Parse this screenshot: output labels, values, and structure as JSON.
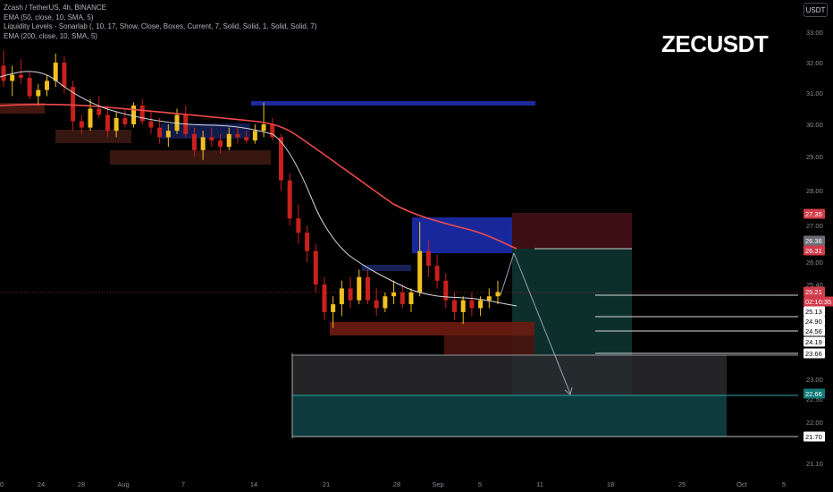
{
  "legend": {
    "symbol_line": "Zcash / TetherUS, 4h, BINANCE",
    "ema50_line": "EMA (50, close, 10, SMA, 5)",
    "liquidity_line": "Liquidity Levels - Sonarlab (, 10, 17, Show, Close, Boxes, Current, 7, Solid, Solid, 1, Solid, Solid, 7)",
    "ema200_line": "EMA (200, close, 10, SMA, 5)"
  },
  "title": "ZECUSDT",
  "currency_button": "USDT",
  "colors": {
    "background": "#000000",
    "up": "#f0c020",
    "down": "#c8201c",
    "ema50": "#d8d8d8",
    "ema200": "#f04a4a",
    "supply_box": "#1c2a9c",
    "demand_box": "#7a1c14",
    "tp_zone": "#0d3a36",
    "sl_zone": "#3a0f14",
    "accent_teal": "#137a7a",
    "accent_red": "#d23c4a",
    "text": "#b2b5be"
  },
  "chart_data": {
    "type": "candlestick",
    "symbol": "ZECUSDT",
    "exchange": "BINANCE",
    "timeframe": "4h",
    "y_axis": {
      "ticks": [
        "33.00",
        "32.00",
        "31.00",
        "30.00",
        "29.00",
        "28.00",
        "27.00",
        "26.00",
        "25.40",
        "23.00",
        "22.50",
        "22.00",
        "21.10"
      ]
    },
    "x_axis": {
      "ticks": [
        "0",
        "24",
        "28",
        "Aug",
        "7",
        "14",
        "21",
        "28",
        "Sep",
        "5",
        "11",
        "18",
        "25",
        "Oct",
        "5"
      ]
    },
    "price_labels": [
      {
        "text": "27.35",
        "style": "red"
      },
      {
        "text": "26.36",
        "style": "gray"
      },
      {
        "text": "26.31",
        "style": "red"
      },
      {
        "text": "25.21",
        "style": "red"
      },
      {
        "text": "02:10:35",
        "style": "red"
      },
      {
        "text": "25.13",
        "style": "plain"
      },
      {
        "text": "24.90",
        "style": "plain"
      },
      {
        "text": "24.56",
        "style": "plain"
      },
      {
        "text": "24.19",
        "style": "plain"
      },
      {
        "text": "23.66",
        "style": "plain"
      },
      {
        "text": "22.66",
        "style": "teal"
      },
      {
        "text": "21.70",
        "style": "plain"
      }
    ],
    "ohlc_approx": [
      [
        31.9,
        32.4,
        31.2,
        31.4
      ],
      [
        31.4,
        31.9,
        30.9,
        31.6
      ],
      [
        31.6,
        32.1,
        31.3,
        31.5
      ],
      [
        31.5,
        31.7,
        30.8,
        30.9
      ],
      [
        30.9,
        31.3,
        30.6,
        31.1
      ],
      [
        31.1,
        31.6,
        30.9,
        31.4
      ],
      [
        31.4,
        32.3,
        31.2,
        32.0
      ],
      [
        32.0,
        32.2,
        31.0,
        31.2
      ],
      [
        31.2,
        31.4,
        29.8,
        30.1
      ],
      [
        30.1,
        30.3,
        29.7,
        29.9
      ],
      [
        29.9,
        30.8,
        29.8,
        30.5
      ],
      [
        30.5,
        30.9,
        30.2,
        30.3
      ],
      [
        30.3,
        30.6,
        29.6,
        29.8
      ],
      [
        29.8,
        30.4,
        29.6,
        30.2
      ],
      [
        30.2,
        30.5,
        29.9,
        30.0
      ],
      [
        30.0,
        30.7,
        29.9,
        30.6
      ],
      [
        30.6,
        30.8,
        30.0,
        30.1
      ],
      [
        30.1,
        30.4,
        29.7,
        29.9
      ],
      [
        29.9,
        30.2,
        29.4,
        29.6
      ],
      [
        29.6,
        30.0,
        29.3,
        29.8
      ],
      [
        29.8,
        30.5,
        29.7,
        30.3
      ],
      [
        30.3,
        30.6,
        29.6,
        29.7
      ],
      [
        29.7,
        29.9,
        29.0,
        29.2
      ],
      [
        29.2,
        29.8,
        28.9,
        29.6
      ],
      [
        29.6,
        29.9,
        29.3,
        29.5
      ],
      [
        29.5,
        29.7,
        29.1,
        29.3
      ],
      [
        29.3,
        29.9,
        29.2,
        29.7
      ],
      [
        29.7,
        29.9,
        29.4,
        29.6
      ],
      [
        29.6,
        29.8,
        29.4,
        29.5
      ],
      [
        29.5,
        30.0,
        29.4,
        29.8
      ],
      [
        29.8,
        30.7,
        29.6,
        30.0
      ],
      [
        30.0,
        30.2,
        29.5,
        29.6
      ],
      [
        29.6,
        29.7,
        28.0,
        28.3
      ],
      [
        28.3,
        28.5,
        27.0,
        27.2
      ],
      [
        27.2,
        27.6,
        26.5,
        26.8
      ],
      [
        26.8,
        27.0,
        26.0,
        26.3
      ],
      [
        26.3,
        26.5,
        25.2,
        25.4
      ],
      [
        25.4,
        25.6,
        24.5,
        24.7
      ],
      [
        24.7,
        25.1,
        24.3,
        24.9
      ],
      [
        24.9,
        25.5,
        24.6,
        25.3
      ],
      [
        25.3,
        25.6,
        24.8,
        25.0
      ],
      [
        25.0,
        25.8,
        24.9,
        25.6
      ],
      [
        25.6,
        25.8,
        24.9,
        25.0
      ],
      [
        25.0,
        25.3,
        24.6,
        24.8
      ],
      [
        24.8,
        25.2,
        24.7,
        25.1
      ],
      [
        25.1,
        25.5,
        24.9,
        25.2
      ],
      [
        25.2,
        25.4,
        24.8,
        24.9
      ],
      [
        24.9,
        25.3,
        24.7,
        25.2
      ],
      [
        25.2,
        27.1,
        25.1,
        26.3
      ],
      [
        26.3,
        26.6,
        25.6,
        25.9
      ],
      [
        25.9,
        26.2,
        25.3,
        25.5
      ],
      [
        25.5,
        25.7,
        24.8,
        25.0
      ],
      [
        25.0,
        25.2,
        24.5,
        24.7
      ],
      [
        24.7,
        25.1,
        24.4,
        25.0
      ],
      [
        25.0,
        25.2,
        24.6,
        24.8
      ],
      [
        24.8,
        25.1,
        24.6,
        25.0
      ],
      [
        25.0,
        25.3,
        24.8,
        25.1
      ],
      [
        25.1,
        25.5,
        24.9,
        25.21
      ]
    ],
    "levels": {
      "entry": 26.31,
      "stop": 27.35,
      "targets": [
        22.66,
        21.7
      ]
    }
  }
}
